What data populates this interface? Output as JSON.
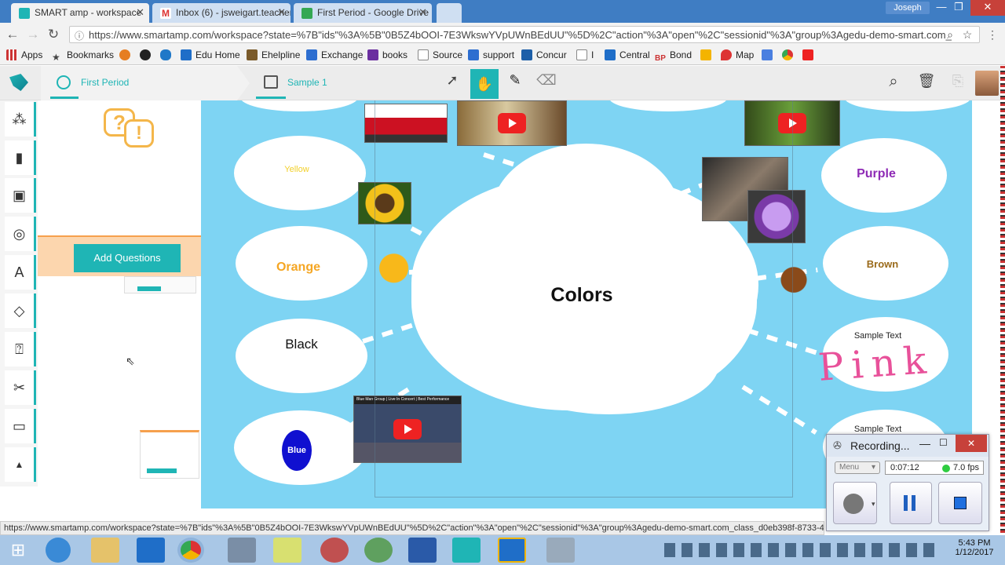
{
  "browser": {
    "tabs": [
      {
        "label": "SMART amp - workspace",
        "active": true
      },
      {
        "label": "Inbox (6) - jsweigart.teacher",
        "active": false
      },
      {
        "label": "First Period - Google Drive",
        "active": false
      }
    ],
    "profile_name": "Joseph",
    "url": "https://www.smartamp.com/workspace?state=%7B\"ids\"%3A%5B\"0B5Z4bOOI-7E3WkswYVpUWnBEdUU\"%5D%2C\"action\"%3A\"open\"%2C\"sessionid\"%3A\"group%3Agedu-demo-smart.com_",
    "bookmarks": [
      "Apps",
      "Bookmarks",
      "Edu Home",
      "Ehelpline",
      "Exchange",
      "books",
      "Source",
      "support",
      "Concur",
      "Central",
      "Bond",
      "Map"
    ]
  },
  "app": {
    "breadcrumb_class": "First Period",
    "breadcrumb_workspace": "Sample 1",
    "add_questions_label": "Add Questions"
  },
  "canvas": {
    "center_label": "Colors",
    "labels": {
      "yellow": "Yellow",
      "orange": "Orange",
      "black": "Black",
      "blue": "Blue",
      "purple": "Purple",
      "brown": "Brown",
      "sample1": "Sample Text",
      "sample2": "Sample Text",
      "ink": "Pink"
    },
    "video_caption": "Blue Man Group | Live In Concert | Best Performance"
  },
  "status_url": "https://www.smartamp.com/workspace?state=%7B\"ids\"%3A%5B\"0B5Z4bOOI-7E3WkswYVpUWnBEdUU\"%5D%2C\"action\"%3A\"open\"%2C\"sessionid\"%3A\"group%3Agedu-demo-smart.com_class_d0eb398f-8733-4",
  "recorder": {
    "title": "Recording...",
    "menu_label": "Menu",
    "elapsed": "0:07:12",
    "fps": "7.0 fps"
  },
  "taskbar": {
    "time": "5:43 PM",
    "date": "1/12/2017"
  },
  "colors": {
    "teal": "#1fb5b5",
    "canvas_bg": "#7ed4f3",
    "browser_chrome": "#3f7dc3",
    "yellow_text": "#f2d02a",
    "orange_text": "#f5a623",
    "purple_text": "#8e2ab5",
    "brown_text": "#9a6a1a",
    "ink_pink": "#e8519a"
  }
}
